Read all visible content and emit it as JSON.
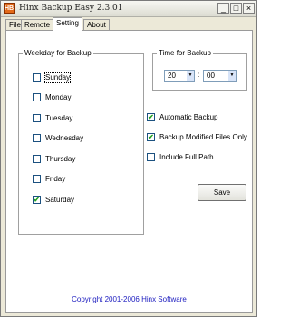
{
  "window": {
    "title": "Hinx Backup Easy 2.3.01",
    "app_icon": "HB",
    "controls": {
      "minimize": "_",
      "maximize": "□",
      "close": "×"
    }
  },
  "tabs": [
    {
      "label": "File",
      "active": false
    },
    {
      "label": "Remote",
      "active": false
    },
    {
      "label": "Setting",
      "active": true
    },
    {
      "label": "About",
      "active": false
    }
  ],
  "weekday": {
    "legend": "Weekday for Backup",
    "days": [
      {
        "label": "Sunday",
        "checked": false
      },
      {
        "label": "Monday",
        "checked": false
      },
      {
        "label": "Tuesday",
        "checked": false
      },
      {
        "label": "Wednesday",
        "checked": false
      },
      {
        "label": "Thursday",
        "checked": false
      },
      {
        "label": "Friday",
        "checked": false
      },
      {
        "label": "Saturday",
        "checked": true
      }
    ],
    "check_glyph": "✔"
  },
  "time": {
    "legend": "Time for Backup",
    "hour": "20",
    "minute": "00",
    "separator": ":",
    "arrow": "▼"
  },
  "options": [
    {
      "label": "Automatic Backup",
      "checked": true
    },
    {
      "label": "Backup Modified Files Only",
      "checked": true
    },
    {
      "label": "Include Full Path",
      "checked": false
    }
  ],
  "save_label": "Save",
  "footer": {
    "copyright": "Copyright 2001-2006 Hinx Software"
  },
  "colors": {
    "link_blue": "#2020c0",
    "check_green": "#21a121"
  }
}
